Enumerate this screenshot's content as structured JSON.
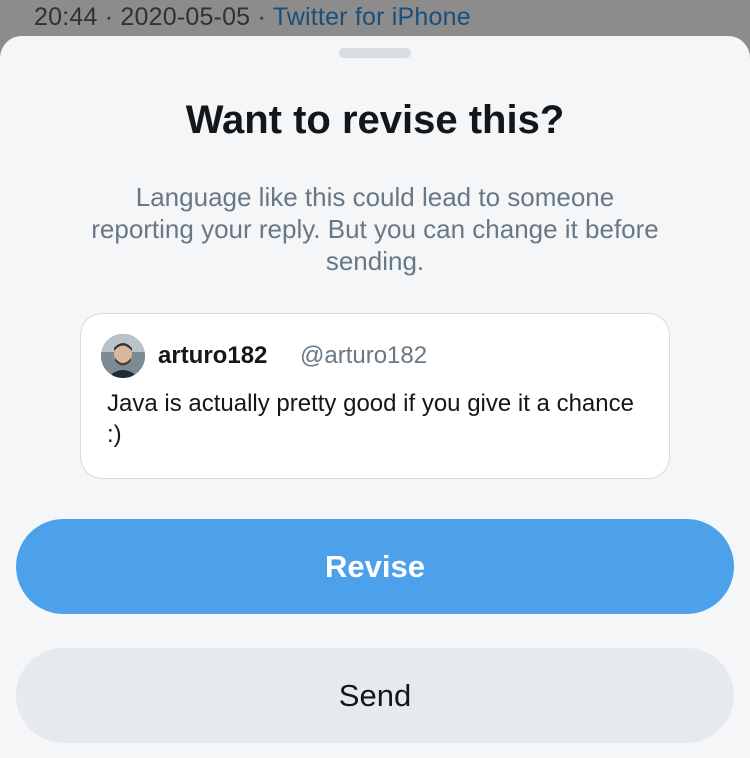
{
  "background": {
    "time": "20:44",
    "separator_1": "·",
    "date": "2020-05-05",
    "separator_2": "·",
    "source": "Twitter for iPhone"
  },
  "dialog": {
    "title": "Want to revise this?",
    "message": "Language like this could lead to someone reporting your reply. But you can change it before sending."
  },
  "preview": {
    "display_name": "arturo182",
    "handle": "@arturo182",
    "text": "Java is actually pretty good if you give it a chance :)"
  },
  "actions": {
    "revise_label": "Revise",
    "send_label": "Send"
  },
  "colors": {
    "accent": "#4ca1ea",
    "secondary_button": "#e6eaee",
    "sheet_background": "#f4f6f8",
    "muted_text": "#697885"
  }
}
